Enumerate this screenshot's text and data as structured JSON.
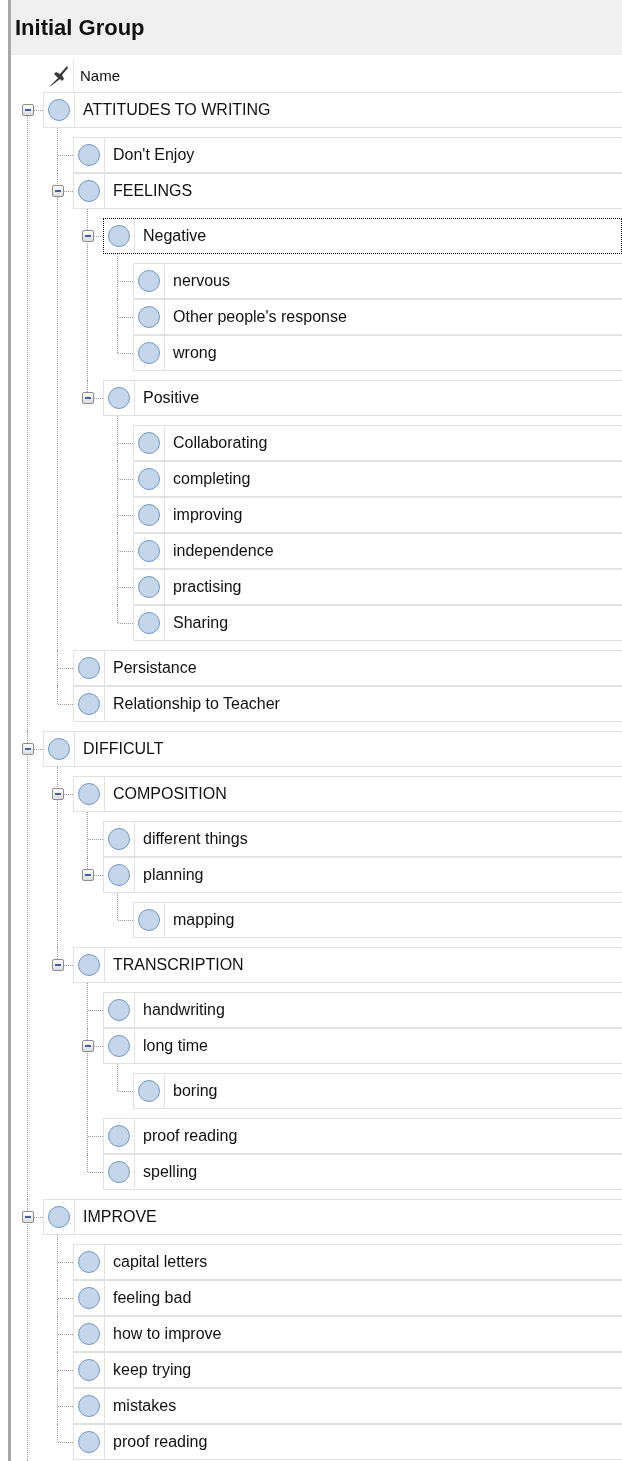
{
  "title": "Initial Group",
  "header": {
    "column": "Name"
  },
  "nodes": [
    {
      "label": "ATTITUDES TO WRITING",
      "selected": false,
      "expanded": true,
      "children": [
        {
          "label": "Don't Enjoy",
          "selected": false
        },
        {
          "label": "FEELINGS",
          "selected": false,
          "expanded": true,
          "children": [
            {
              "label": "Negative",
              "selected": true,
              "expanded": true,
              "children": [
                {
                  "label": "nervous",
                  "selected": false
                },
                {
                  "label": "Other people's response",
                  "selected": false
                },
                {
                  "label": "wrong",
                  "selected": false
                }
              ]
            },
            {
              "label": "Positive",
              "selected": false,
              "expanded": true,
              "children": [
                {
                  "label": "Collaborating",
                  "selected": false
                },
                {
                  "label": "completing",
                  "selected": false
                },
                {
                  "label": "improving",
                  "selected": false
                },
                {
                  "label": "independence",
                  "selected": false
                },
                {
                  "label": "practising",
                  "selected": false
                },
                {
                  "label": "Sharing",
                  "selected": false
                }
              ]
            }
          ]
        },
        {
          "label": "Persistance",
          "selected": false
        },
        {
          "label": "Relationship to Teacher",
          "selected": false
        }
      ]
    },
    {
      "label": "DIFFICULT",
      "selected": false,
      "expanded": true,
      "children": [
        {
          "label": "COMPOSITION",
          "selected": false,
          "expanded": true,
          "children": [
            {
              "label": "different things",
              "selected": false
            },
            {
              "label": "planning",
              "selected": false,
              "expanded": true,
              "children": [
                {
                  "label": "mapping",
                  "selected": false
                }
              ]
            }
          ]
        },
        {
          "label": "TRANSCRIPTION",
          "selected": false,
          "expanded": true,
          "children": [
            {
              "label": "handwriting",
              "selected": false
            },
            {
              "label": "long time",
              "selected": false,
              "expanded": true,
              "children": [
                {
                  "label": "boring",
                  "selected": false
                }
              ]
            },
            {
              "label": "proof reading",
              "selected": false
            },
            {
              "label": "spelling",
              "selected": false
            }
          ]
        }
      ]
    },
    {
      "label": "IMPROVE",
      "selected": false,
      "expanded": true,
      "children": [
        {
          "label": "capital letters",
          "selected": false
        },
        {
          "label": "feeling bad",
          "selected": false
        },
        {
          "label": "how to improve",
          "selected": false
        },
        {
          "label": "keep trying",
          "selected": false
        },
        {
          "label": "mistakes",
          "selected": false
        },
        {
          "label": "proof reading",
          "selected": false
        }
      ]
    }
  ]
}
